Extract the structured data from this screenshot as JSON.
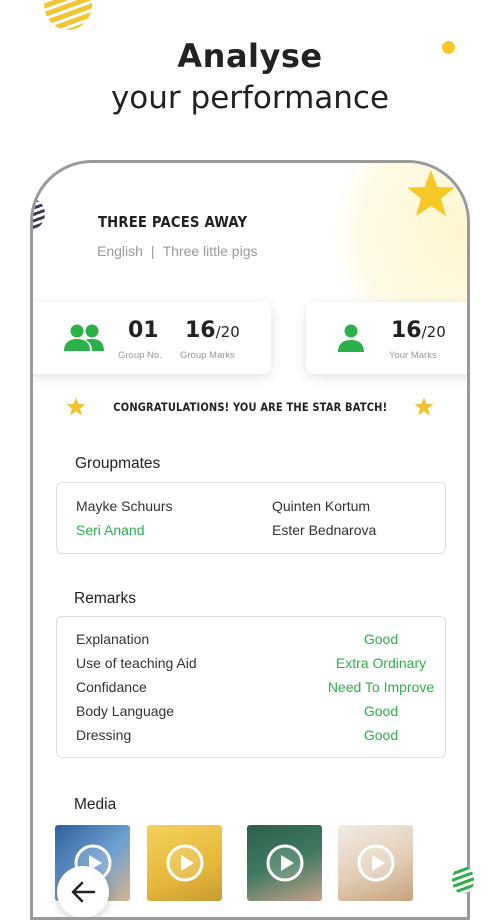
{
  "headline": {
    "line1": "Analyse",
    "line2": "your performance"
  },
  "app": {
    "title": "THREE PACES AWAY",
    "subject": "English",
    "topic": "Three little pigs",
    "group_card": {
      "group_no": "01",
      "group_no_label": "Group No.",
      "group_marks": "16",
      "group_marks_total": "/20",
      "group_marks_label": "Group Marks"
    },
    "your_card": {
      "your_marks": "16",
      "your_marks_total": "/20",
      "your_marks_label": "Your Marks"
    },
    "congrats": "CONGRATULATIONS! YOU ARE THE STAR BATCH!",
    "groupmates": {
      "heading": "Groupmates",
      "names": [
        "Mayke Schuurs",
        "Quinten Kortum",
        "Seri Anand",
        "Ester Bednarova"
      ]
    },
    "remarks": {
      "heading": "Remarks",
      "rows": [
        {
          "label": "Explanation",
          "value": "Good"
        },
        {
          "label": "Use of teaching Aid",
          "value": "Extra Ordinary"
        },
        {
          "label": "Confidance",
          "value": "Need To Improve"
        },
        {
          "label": "Body Language",
          "value": "Good"
        },
        {
          "label": "Dressing",
          "value": "Good"
        }
      ]
    },
    "media": {
      "heading": "Media"
    }
  },
  "colors": {
    "accent": "#2bb04a",
    "star": "#f7c928"
  },
  "icons": [
    "group-icon",
    "person-icon",
    "star-icon",
    "play-icon",
    "back-arrow-icon"
  ]
}
